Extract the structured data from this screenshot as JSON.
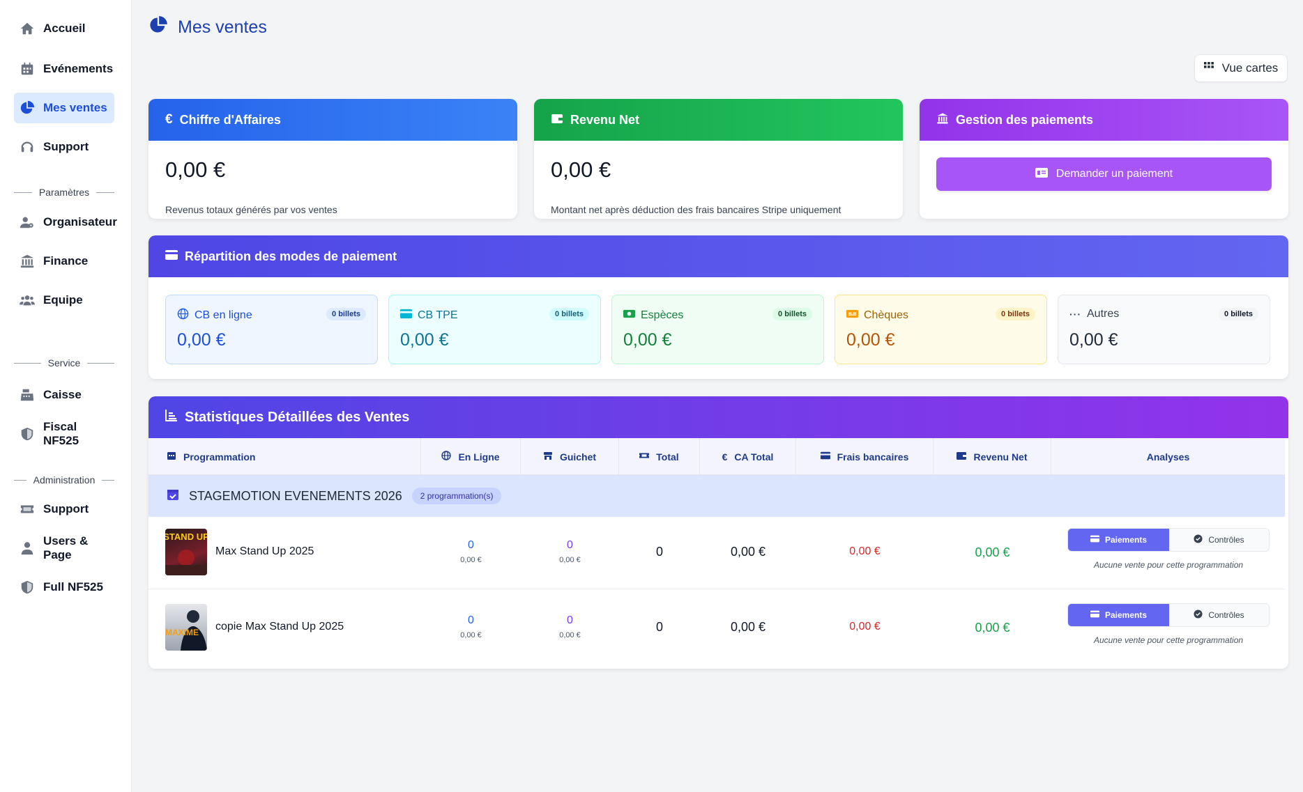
{
  "sidebar": {
    "items": [
      {
        "label": "Accueil",
        "icon": "home-icon"
      },
      {
        "label": "Evénements",
        "icon": "calendar-icon"
      },
      {
        "label": "Mes ventes",
        "icon": "pie-chart-icon",
        "active": true
      },
      {
        "label": "Support",
        "icon": "headset-icon"
      }
    ],
    "section_parametres": "Paramètres",
    "parametres_items": [
      {
        "label": "Organisateur",
        "icon": "user-gear-icon"
      },
      {
        "label": "Finance",
        "icon": "bank-icon"
      },
      {
        "label": "Equipe",
        "icon": "users-icon"
      }
    ],
    "section_service": "Service",
    "service_items": [
      {
        "label": "Caisse",
        "icon": "cash-register-icon"
      },
      {
        "label": "Fiscal NF525",
        "icon": "shield-icon"
      }
    ],
    "section_admin": "Administration",
    "admin_items": [
      {
        "label": "Support",
        "icon": "ticket-icon"
      },
      {
        "label": "Users & Page",
        "icon": "user-icon"
      },
      {
        "label": "Full NF525",
        "icon": "shield-icon"
      }
    ]
  },
  "header": {
    "title": "Mes ventes",
    "view_button": "Vue cartes"
  },
  "cards": {
    "ca": {
      "title": "Chiffre d'Affaires",
      "amount": "0,00 €",
      "desc": "Revenus totaux générés par vos ventes",
      "color": "#2563eb"
    },
    "net": {
      "title": "Revenu Net",
      "amount": "0,00 €",
      "desc": "Montant net après déduction des frais bancaires Stripe uniquement",
      "color": "#16a34a"
    },
    "payments": {
      "title": "Gestion des paiements",
      "button": "Demander un paiement",
      "color": "#a855f7"
    }
  },
  "repartition": {
    "title": "Répartition des modes de paiement",
    "modes": [
      {
        "label": "CB en ligne",
        "badge": "0 billets",
        "amount": "0,00 €",
        "icon": "globe-icon"
      },
      {
        "label": "CB TPE",
        "badge": "0 billets",
        "amount": "0,00 €",
        "icon": "credit-card-icon"
      },
      {
        "label": "Espèces",
        "badge": "0 billets",
        "amount": "0,00 €",
        "icon": "money-icon"
      },
      {
        "label": "Chèques",
        "badge": "0 billets",
        "amount": "0,00 €",
        "icon": "cheque-icon"
      },
      {
        "label": "Autres",
        "badge": "0 billets",
        "amount": "0,00 €",
        "icon": "more-icon"
      }
    ]
  },
  "stats": {
    "title": "Statistiques Détaillées des Ventes",
    "columns": [
      "Programmation",
      "En Ligne",
      "Guichet",
      "Total",
      "CA Total",
      "Frais bancaires",
      "Revenu Net",
      "Analyses"
    ],
    "group": {
      "name": "STAGEMOTION EVENEMENTS 2026",
      "badge": "2 programmation(s)"
    },
    "rows": [
      {
        "name": "Max Stand Up 2025",
        "en_ligne": "0",
        "en_ligne_amt": "0,00 €",
        "guichet": "0",
        "guichet_amt": "0,00 €",
        "total": "0",
        "ca_total": "0,00 €",
        "frais": "0,00 €",
        "net": "0,00 €",
        "btn_paiements": "Paiements",
        "btn_controles": "Contrôles",
        "note": "Aucune vente pour cette programmation",
        "thumb_text": "STAND UP"
      },
      {
        "name": "copie Max Stand Up 2025",
        "en_ligne": "0",
        "en_ligne_amt": "0,00 €",
        "guichet": "0",
        "guichet_amt": "0,00 €",
        "total": "0",
        "ca_total": "0,00 €",
        "frais": "0,00 €",
        "net": "0,00 €",
        "btn_paiements": "Paiements",
        "btn_controles": "Contrôles",
        "note": "Aucune vente pour cette programmation",
        "thumb_text": "MAXIME"
      }
    ]
  }
}
